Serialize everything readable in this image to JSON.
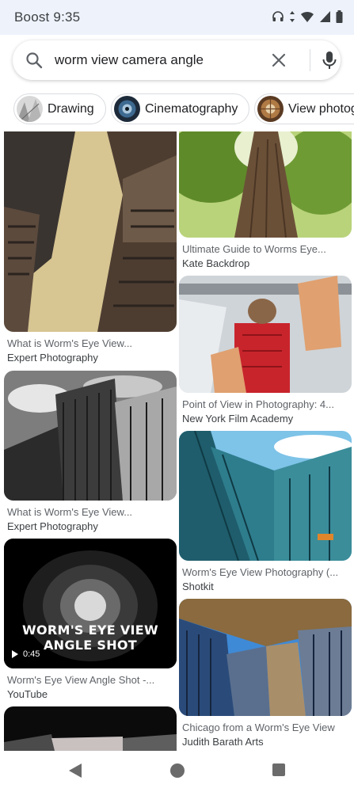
{
  "status_bar": {
    "carrier": "Boost",
    "time": "9:35",
    "icons": [
      "headphones-icon",
      "data-arrows-icon",
      "wifi-icon",
      "cell-signal-icon",
      "battery-icon"
    ]
  },
  "search": {
    "query": "worm view camera angle",
    "icons": [
      "search-icon",
      "clear-icon",
      "mic-icon"
    ]
  },
  "chips": [
    {
      "label": "Drawing"
    },
    {
      "label": "Cinematography"
    },
    {
      "label": "View photog"
    }
  ],
  "results": [
    {
      "title": "What is Worm's Eye View...",
      "source": "Expert Photography"
    },
    {
      "title": "Ultimate Guide to Worms Eye...",
      "source": "Kate Backdrop"
    },
    {
      "title": "Point of View in Photography: 4...",
      "source": "New York Film Academy"
    },
    {
      "title": "What is Worm's Eye View...",
      "source": "Expert Photography"
    },
    {
      "title": "Worm's Eye View Photography (...",
      "source": "Shotkit"
    },
    {
      "title": "Worm's Eye View Angle Shot -...",
      "source": "YouTube",
      "overlay": "WORM'S EYE VIEW ANGLE SHOT",
      "duration": "0:45"
    },
    {
      "title": "Chicago from a Worm's Eye View",
      "source": "Judith Barath Arts"
    }
  ],
  "nav": [
    "back-icon",
    "home-icon",
    "recents-icon"
  ],
  "colors": {
    "status_bg": "#eef2fb",
    "text_primary": "#202124",
    "text_secondary": "#5f6368",
    "border": "#dadce0"
  }
}
